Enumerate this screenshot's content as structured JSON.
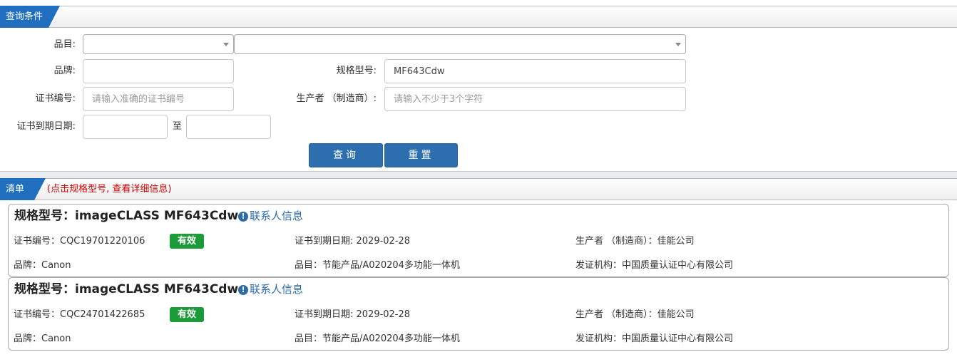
{
  "query_section": {
    "title": "查询条件",
    "category_label": "品目:",
    "brand_label": "品牌:",
    "brand_value": "",
    "model_label": "规格型号:",
    "model_value": "MF643Cdw",
    "cert_no_label": "证书编号:",
    "cert_no_placeholder": "请输入准确的证书编号",
    "manufacturer_label": "生产者 （制造商）:",
    "manufacturer_placeholder": "请输入不少于3个字符",
    "expiry_label": "证书到期日期:",
    "expiry_to": "至",
    "search_button": "查询",
    "reset_button": "重置"
  },
  "list_section": {
    "title": "清单",
    "note": "(点击规格型号, 查看详细信息)",
    "items": [
      {
        "model": "规格型号：imageCLASS MF643Cdw",
        "contact": "联系人信息",
        "cert_no": "证书编号：CQC19701220106",
        "status": "有效",
        "expiry": "证书到期日期: 2029-02-28",
        "manufacturer": "生产者 （制造商）：佳能公司",
        "brand": "品牌：Canon",
        "category": "品目：节能产品/A020204多功能一体机",
        "issuer": "发证机构：中国质量认证中心有限公司"
      },
      {
        "model": "规格型号：imageCLASS MF643Cdw",
        "contact": "联系人信息",
        "cert_no": "证书编号：CQC24701422685",
        "status": "有效",
        "expiry": "证书到期日期: 2029-02-28",
        "manufacturer": "生产者 （制造商）：佳能公司",
        "brand": "品牌：Canon",
        "category": "品目：节能产品/A020204多功能一体机",
        "issuer": "发证机构：中国质量认证中心有限公司"
      }
    ]
  },
  "colors": {
    "accent": "#1f6fbe",
    "button": "#2d6fae",
    "valid_badge": "#1b9b3a",
    "note": "#d40000"
  }
}
